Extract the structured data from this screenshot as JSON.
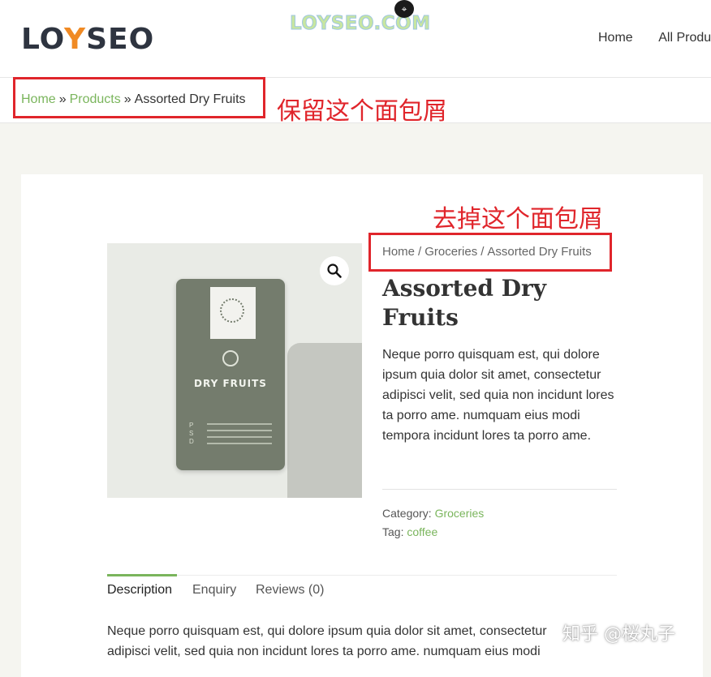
{
  "header": {
    "logo": {
      "pre": "LO",
      "y": "Y",
      "post": "SEO"
    },
    "watermark": "LOYSEO.COM",
    "nav": [
      "Home",
      "All Produ"
    ]
  },
  "breadcrumb_top": {
    "home": "Home",
    "sep": "»",
    "products": "Products",
    "current": "Assorted Dry Fruits"
  },
  "annotations": {
    "keep": "保留这个面包屑",
    "remove": "去掉这个面包屑"
  },
  "breadcrumb_inner": {
    "home": "Home",
    "sep": "/",
    "category": "Groceries",
    "current": "Assorted Dry Fruits"
  },
  "product": {
    "image_title": "DRY FRUITS",
    "title": "Assorted Dry Fruits",
    "description": "Neque porro quisquam est, qui dolore ipsum quia dolor sit amet, consectetur adipisci velit, sed quia non incidunt lores ta porro ame. numquam eius modi tempora incidunt lores ta porro ame.",
    "category_label": "Category:",
    "category_value": "Groceries",
    "tag_label": "Tag:",
    "tag_value": "coffee"
  },
  "tabs": [
    {
      "label": "Description",
      "active": true
    },
    {
      "label": "Enquiry",
      "active": false
    },
    {
      "label": "Reviews (0)",
      "active": false
    }
  ],
  "tab_content": {
    "line1": "Neque porro quisquam est, qui dolore ipsum quia dolor sit amet, consectetur",
    "line2": "adipisci velit, sed quia non incidunt lores ta porro ame. numquam eius modi"
  },
  "corner_watermark": "知乎 @桜丸子",
  "colors": {
    "accent": "#7ab55c",
    "annotation": "#e0252b",
    "logo_dark": "#2e3440",
    "logo_orange": "#f08a24"
  },
  "icons": {
    "zoom": "search-icon",
    "watermark": "scan-icon"
  }
}
